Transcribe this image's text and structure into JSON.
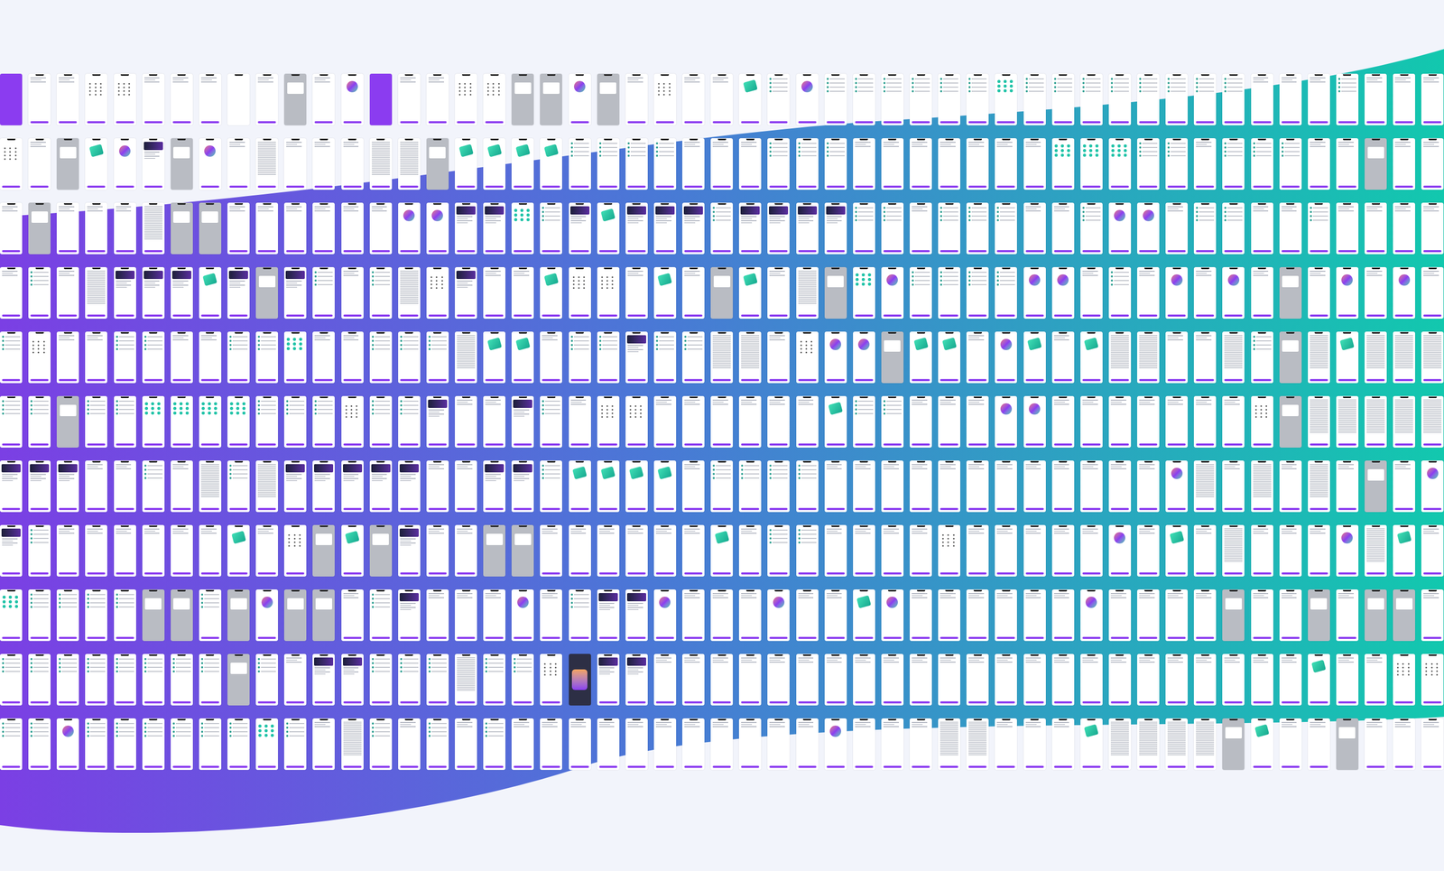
{
  "rows": [
    {
      "screens": [
        "purple",
        "form",
        "form",
        "keypad",
        "keypad",
        "form",
        "form",
        "form",
        "blank",
        "form",
        "gray",
        "form",
        "person",
        "purple",
        "form",
        "form",
        "keypad",
        "keypad",
        "gray",
        "gray",
        "person",
        "gray",
        "form",
        "keypad",
        "form",
        "form",
        "hero",
        "list",
        "person",
        "list",
        "list",
        "list",
        "list",
        "list",
        "list",
        "teal",
        "list",
        "list",
        "list",
        "list",
        "list",
        "list",
        "list",
        "list",
        "form",
        "form",
        "form",
        "list",
        "form",
        "form",
        "form"
      ]
    },
    {
      "screens": [
        "keypad",
        "form",
        "gray",
        "hero",
        "person",
        "card",
        "gray",
        "person",
        "form",
        "text",
        "form",
        "form",
        "form",
        "text",
        "text",
        "gray",
        "hero",
        "hero",
        "hero",
        "hero",
        "list",
        "list",
        "list",
        "list",
        "form",
        "form",
        "form",
        "list",
        "list",
        "list",
        "form",
        "form",
        "form",
        "form",
        "form",
        "form",
        "form",
        "teal",
        "teal",
        "teal",
        "list",
        "list",
        "form",
        "list",
        "list",
        "list",
        "form",
        "form",
        "gray",
        "form",
        "form"
      ]
    },
    {
      "screens": [
        "form",
        "gray",
        "form",
        "form",
        "form",
        "text",
        "gray",
        "gray",
        "form",
        "form",
        "form",
        "form",
        "form",
        "form",
        "person",
        "person",
        "card",
        "card",
        "teal",
        "list",
        "card",
        "hero",
        "card",
        "card",
        "card",
        "list",
        "card",
        "card",
        "card",
        "card",
        "list",
        "list",
        "form",
        "list",
        "list",
        "list",
        "form",
        "form",
        "list",
        "person",
        "person",
        "form",
        "list",
        "list",
        "form",
        "form",
        "list",
        "form",
        "form",
        "form",
        "form"
      ]
    },
    {
      "screens": [
        "form",
        "list",
        "form",
        "text",
        "card",
        "card",
        "card",
        "hero",
        "card",
        "gray",
        "card",
        "list",
        "form",
        "list",
        "text",
        "keypad",
        "card",
        "form",
        "form",
        "hero",
        "keypad",
        "keypad",
        "form",
        "hero",
        "form",
        "gray",
        "hero",
        "form",
        "text",
        "gray",
        "teal",
        "person",
        "list",
        "list",
        "list",
        "list",
        "person",
        "person",
        "form",
        "list",
        "form",
        "person",
        "form",
        "person",
        "form",
        "gray",
        "form",
        "person",
        "form",
        "person",
        "form"
      ]
    },
    {
      "screens": [
        "list",
        "keypad",
        "form",
        "form",
        "list",
        "list",
        "form",
        "form",
        "list",
        "list",
        "teal",
        "form",
        "form",
        "list",
        "list",
        "list",
        "text",
        "hero",
        "hero",
        "form",
        "list",
        "list",
        "card",
        "list",
        "list",
        "text",
        "text",
        "form",
        "keypad",
        "person",
        "person",
        "gray",
        "hero",
        "hero",
        "form",
        "person",
        "hero",
        "form",
        "hero",
        "text",
        "text",
        "form",
        "form",
        "text",
        "list",
        "gray",
        "text",
        "hero",
        "text",
        "text",
        "text"
      ]
    },
    {
      "screens": [
        "list",
        "list",
        "gray",
        "list",
        "list",
        "teal",
        "teal",
        "teal",
        "teal",
        "list",
        "list",
        "list",
        "keypad",
        "list",
        "list",
        "card",
        "form",
        "form",
        "card",
        "list",
        "form",
        "keypad",
        "keypad",
        "form",
        "form",
        "form",
        "form",
        "form",
        "form",
        "hero",
        "list",
        "list",
        "form",
        "form",
        "form",
        "person",
        "person",
        "form",
        "form",
        "form",
        "form",
        "form",
        "form",
        "form",
        "keypad",
        "gray",
        "text",
        "text",
        "text",
        "text",
        "text"
      ]
    },
    {
      "screens": [
        "card",
        "card",
        "card",
        "form",
        "form",
        "list",
        "form",
        "text",
        "list",
        "text",
        "card",
        "card",
        "card",
        "card",
        "card",
        "form",
        "form",
        "card",
        "card",
        "list",
        "hero",
        "hero",
        "hero",
        "hero",
        "form",
        "list",
        "list",
        "list",
        "list",
        "form",
        "form",
        "form",
        "form",
        "form",
        "form",
        "form",
        "form",
        "form",
        "form",
        "form",
        "form",
        "person",
        "text",
        "form",
        "text",
        "form",
        "text",
        "form",
        "gray",
        "form",
        "person"
      ]
    },
    {
      "screens": [
        "card",
        "list",
        "form",
        "form",
        "form",
        "form",
        "form",
        "form",
        "hero",
        "form",
        "keypad",
        "gray",
        "hero",
        "gray",
        "card",
        "form",
        "form",
        "gray",
        "gray",
        "form",
        "form",
        "form",
        "form",
        "form",
        "form",
        "hero",
        "form",
        "list",
        "list",
        "form",
        "form",
        "form",
        "form",
        "keypad",
        "form",
        "form",
        "form",
        "form",
        "form",
        "person",
        "form",
        "hero",
        "form",
        "text",
        "form",
        "form",
        "form",
        "person",
        "text",
        "hero",
        "form"
      ]
    },
    {
      "screens": [
        "teal",
        "list",
        "list",
        "list",
        "list",
        "gray",
        "gray",
        "list",
        "gray",
        "person",
        "gray",
        "gray",
        "form",
        "list",
        "card",
        "form",
        "form",
        "form",
        "person",
        "form",
        "list",
        "card",
        "card",
        "person",
        "form",
        "form",
        "form",
        "person",
        "form",
        "form",
        "hero",
        "person",
        "form",
        "form",
        "form",
        "form",
        "form",
        "form",
        "person",
        "form",
        "form",
        "form",
        "form",
        "gray",
        "form",
        "form",
        "gray",
        "form",
        "gray",
        "gray",
        "form"
      ]
    },
    {
      "screens": [
        "list",
        "list",
        "list",
        "list",
        "list",
        "list",
        "list",
        "list",
        "gray",
        "list",
        "form",
        "card",
        "card",
        "list",
        "list",
        "list",
        "text",
        "list",
        "list",
        "keypad",
        "dark",
        "card",
        "card",
        "form",
        "form",
        "form",
        "form",
        "form",
        "form",
        "form",
        "form",
        "form",
        "form",
        "form",
        "form",
        "form",
        "form",
        "form",
        "form",
        "form",
        "form",
        "form",
        "form",
        "form",
        "form",
        "form",
        "hero",
        "form",
        "form",
        "keypad",
        "keypad"
      ]
    },
    {
      "screens": [
        "list",
        "list",
        "person",
        "list",
        "list",
        "list",
        "list",
        "list",
        "list",
        "teal",
        "list",
        "form",
        "text",
        "list",
        "form",
        "list",
        "form",
        "list",
        "form",
        "form",
        "form",
        "form",
        "form",
        "form",
        "form",
        "form",
        "form",
        "form",
        "form",
        "person",
        "form",
        "form",
        "form",
        "text",
        "text",
        "form",
        "form",
        "form",
        "hero",
        "text",
        "text",
        "text",
        "text",
        "gray",
        "hero",
        "form",
        "form",
        "gray",
        "form",
        "form",
        "form"
      ]
    }
  ]
}
